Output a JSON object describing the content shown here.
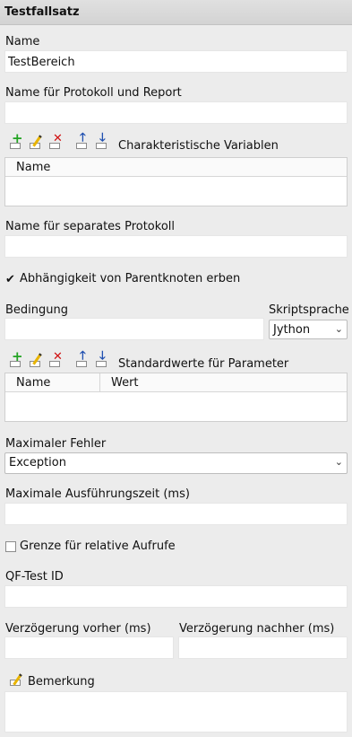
{
  "header": {
    "title": "Testfallsatz"
  },
  "name": {
    "label": "Name",
    "value": "TestBereich"
  },
  "protocol_name": {
    "label": "Name für Protokoll und Report",
    "value": ""
  },
  "char_vars": {
    "label": "Charakteristische Variablen",
    "columns": [
      "Name"
    ]
  },
  "separate_protocol": {
    "label": "Name für separates Protokoll",
    "value": ""
  },
  "inherit_dependency": {
    "label": "Abhängigkeit von Parentknoten erben",
    "checked": true
  },
  "condition": {
    "label": "Bedingung",
    "value": ""
  },
  "script_language": {
    "label": "Skriptsprache",
    "value": "Jython"
  },
  "default_params": {
    "label": "Standardwerte für Parameter",
    "columns": [
      "Name",
      "Wert"
    ]
  },
  "max_error": {
    "label": "Maximaler Fehler",
    "value": "Exception"
  },
  "max_exec_time": {
    "label": "Maximale Ausführungszeit (ms)",
    "value": ""
  },
  "relative_calls": {
    "label": "Grenze für relative Aufrufe",
    "checked": false
  },
  "qftest_id": {
    "label": "QF-Test ID",
    "value": ""
  },
  "delay_before": {
    "label": "Verzögerung vorher (ms)",
    "value": ""
  },
  "delay_after": {
    "label": "Verzögerung nachher (ms)",
    "value": ""
  },
  "remark": {
    "label": "Bemerkung",
    "value": ""
  },
  "colors": {
    "add": "#22a322",
    "delete": "#d01010",
    "move": "#1f4fb0",
    "edit": "#e8b400"
  }
}
